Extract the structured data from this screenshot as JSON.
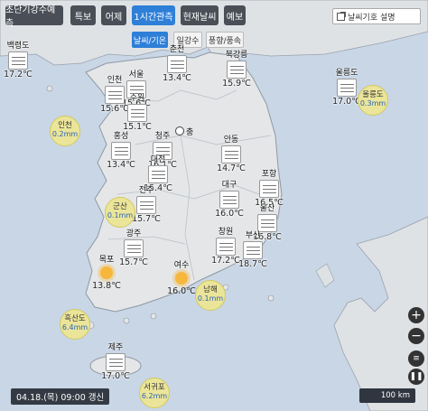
{
  "tabs": [
    {
      "label": "초단기강수예측",
      "active": false
    },
    {
      "label": "특보",
      "active": false
    },
    {
      "label": "어제",
      "active": false
    },
    {
      "label": "1시간관측",
      "active": true
    },
    {
      "label": "현재날씨",
      "active": false
    },
    {
      "label": "예보",
      "active": false
    }
  ],
  "subtabs": [
    {
      "label": "날씨/기온",
      "active": true
    },
    {
      "label": "일강수",
      "active": false
    },
    {
      "label": "풍향/풍속",
      "active": false
    }
  ],
  "legend_button": {
    "label": "날씨기호 설명"
  },
  "stations": [
    {
      "name": "백령도",
      "temp": "17.2℃"
    },
    {
      "name": "서울",
      "temp": "15.6℃"
    },
    {
      "name": "인천",
      "temp": "15.6℃"
    },
    {
      "name": "수원",
      "temp": "15.1℃"
    },
    {
      "name": "춘천",
      "temp": "13.4℃"
    },
    {
      "name": "북강릉",
      "temp": "15.9℃"
    },
    {
      "name": "홍성",
      "temp": "13.4℃"
    },
    {
      "name": "청주",
      "temp": "16.1℃"
    },
    {
      "name": "대전",
      "temp": "15.4℃"
    },
    {
      "name": "안동",
      "temp": "14.7℃"
    },
    {
      "name": "포항",
      "temp": "16.5℃"
    },
    {
      "name": "전주",
      "temp": "15.7℃"
    },
    {
      "name": "대구",
      "temp": "16.0℃"
    },
    {
      "name": "울산",
      "temp": "16.8℃"
    },
    {
      "name": "광주",
      "temp": "15.7℃"
    },
    {
      "name": "창원",
      "temp": "17.2℃"
    },
    {
      "name": "부산",
      "temp": "18.7℃"
    },
    {
      "name": "제주",
      "temp": "17.0℃"
    },
    {
      "name": "울릉도",
      "temp": "17.0℃"
    }
  ],
  "sunny_stations": [
    {
      "name": "목포",
      "temp": "13.8℃"
    },
    {
      "name": "여수",
      "temp": "16.0℃"
    }
  ],
  "rain_bubbles": [
    {
      "name": "인천",
      "value": "0.2mm"
    },
    {
      "name": "군산",
      "value": "0.1mm"
    },
    {
      "name": "남해",
      "value": "0.1mm"
    },
    {
      "name": "흑산도",
      "value": "6.4mm"
    },
    {
      "name": "서귀포",
      "value": "6.2mm"
    },
    {
      "name": "울릉도",
      "value": "0.3mm"
    }
  ],
  "time_badge": "04.18.(목) 09:00 갱신",
  "scale_label": "100 km",
  "zoom": {
    "in": "+",
    "out": "−"
  },
  "colors": {
    "accent": "#2e7fd8",
    "tab_bg": "#4a4f57",
    "rain_bubble": "#ebe59a",
    "sea": "#c8d6e6",
    "land": "#e4e6e8"
  },
  "icons": {
    "sunny": "sun-icon",
    "haze": "haze-icon",
    "legend": "external-link-icon"
  }
}
